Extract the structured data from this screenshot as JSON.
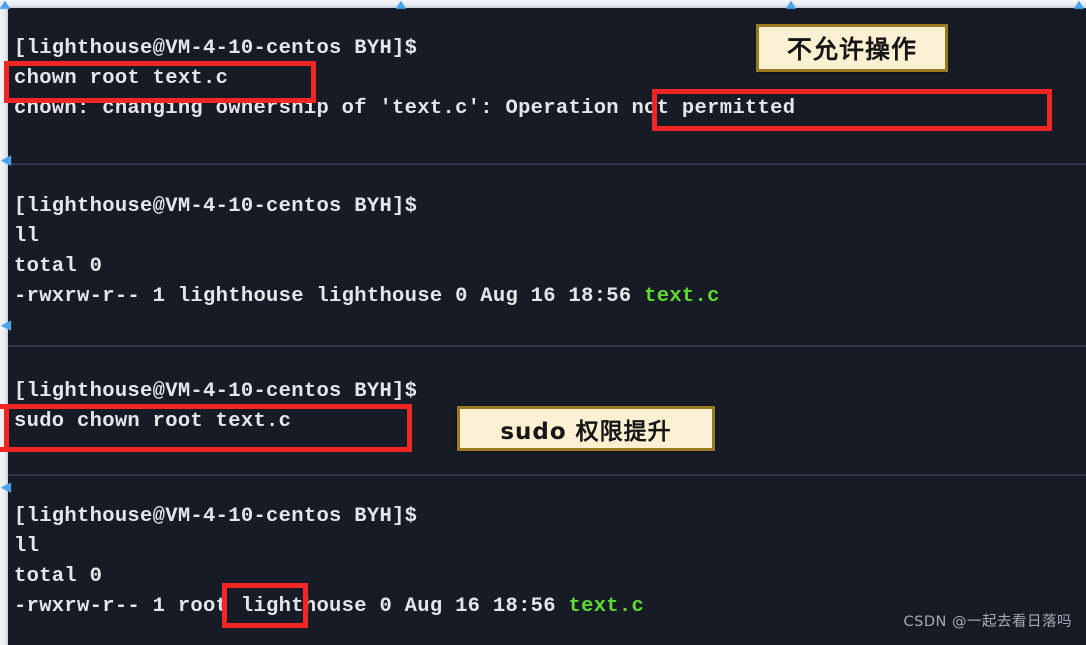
{
  "terminal": {
    "background": "#161b26",
    "foreground": "#e4e6ea",
    "accent_green": "#5ddb2f",
    "highlight_red": "#f42525",
    "callout_bg": "#fbf0d2",
    "callout_border": "#9a7b22",
    "blocks": [
      {
        "id": "block-chown-fail",
        "lines": [
          {
            "text": "[lighthouse@VM-4-10-centos BYH]$",
            "kind": "prompt"
          },
          {
            "text": "chown root text.c",
            "kind": "command"
          },
          {
            "text": "chown: changing ownership of 'text.c': Operation not permitted",
            "kind": "error"
          }
        ]
      },
      {
        "id": "block-ll-before",
        "lines": [
          {
            "text": "[lighthouse@VM-4-10-centos BYH]$",
            "kind": "prompt"
          },
          {
            "text": "ll",
            "kind": "command"
          },
          {
            "text": "total 0",
            "kind": "output"
          },
          {
            "text": "-rwxrw-r-- 1 lighthouse lighthouse 0 Aug 16 18:56 ",
            "suffix": "text.c",
            "kind": "listing"
          }
        ]
      },
      {
        "id": "block-sudo-chown",
        "lines": [
          {
            "text": "[lighthouse@VM-4-10-centos BYH]$",
            "kind": "prompt"
          },
          {
            "text": "sudo chown root text.c",
            "kind": "command"
          }
        ]
      },
      {
        "id": "block-ll-after",
        "lines": [
          {
            "text": "[lighthouse@VM-4-10-centos BYH]$",
            "kind": "prompt"
          },
          {
            "text": "ll",
            "kind": "command"
          },
          {
            "text": "total 0",
            "kind": "output"
          },
          {
            "text": "-rwxrw-r-- 1 root lighthouse 0 Aug 16 18:56 ",
            "suffix": "text.c",
            "kind": "listing"
          }
        ]
      }
    ]
  },
  "annotations": {
    "callouts": [
      {
        "id": "callout-not-permitted",
        "text": "不允许操作"
      },
      {
        "id": "callout-sudo-elevate",
        "text": "sudo 权限提升"
      }
    ],
    "highlights": [
      {
        "id": "highlight-chown-command",
        "target": "chown root text.c"
      },
      {
        "id": "highlight-operation-not-permitted",
        "target": "Operation not permitted"
      },
      {
        "id": "highlight-sudo-command",
        "target": "sudo chown root text.c"
      },
      {
        "id": "highlight-root-owner",
        "target": "root"
      }
    ]
  },
  "watermark": {
    "text": "CSDN @一起去看日落吗"
  }
}
